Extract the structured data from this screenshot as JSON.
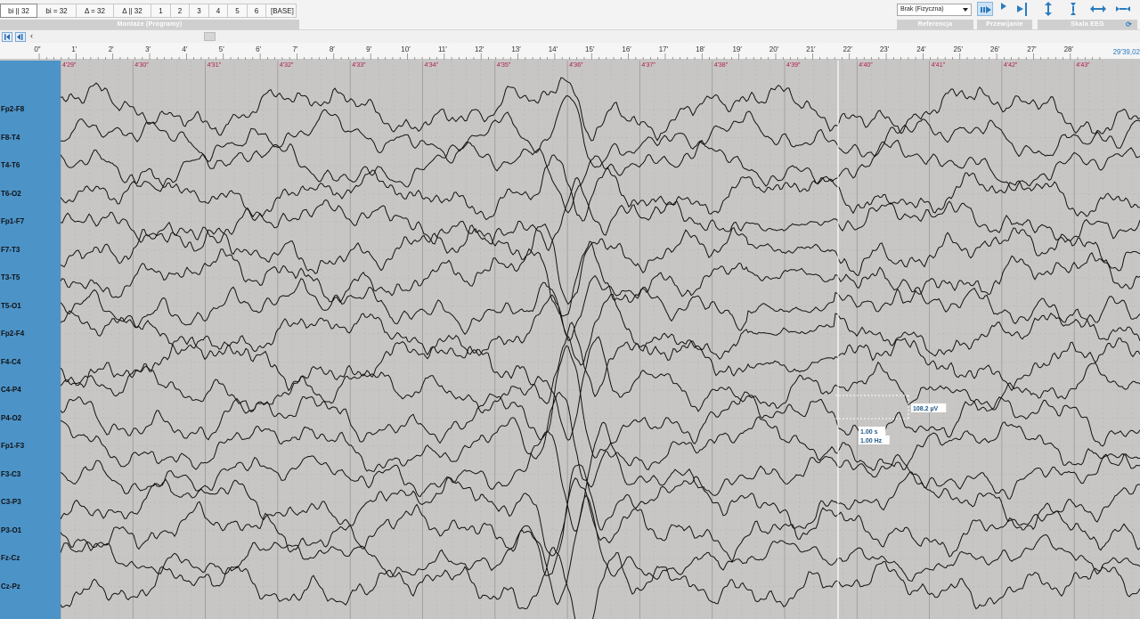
{
  "montage": {
    "buttons": [
      "bi || 32",
      "bi = 32",
      "Δ = 32",
      "Δ || 32",
      "1",
      "2",
      "3",
      "4",
      "5",
      "6",
      "[BASE]"
    ],
    "group_label": "Montaże (Programy)"
  },
  "reference": {
    "selected": "Brak (Fizyczna)",
    "group_label": "Referencja"
  },
  "navigation": {
    "group_label": "Przewijanie",
    "icons": [
      "play-icon",
      "step-forward-icon"
    ]
  },
  "eeg_scale": {
    "group_label": "Skala EEG",
    "icons": [
      "vertical-expand-icon",
      "vertical-shrink-icon",
      "horizontal-expand-icon",
      "horizontal-shrink-icon"
    ]
  },
  "scroll": {
    "left_arrow": "‹",
    "icons": [
      "go-start-icon",
      "step-back-icon"
    ]
  },
  "ruler": {
    "ticks": [
      "0″",
      "1′",
      "2′",
      "3′",
      "4′",
      "5′",
      "6′",
      "7′",
      "8′",
      "9′",
      "10′",
      "11′",
      "12′",
      "13′",
      "14′",
      "15′",
      "16′",
      "17′",
      "18′",
      "19′",
      "20′",
      "21′",
      "22′",
      "23′",
      "24′",
      "25′",
      "26′",
      "27′",
      "28′"
    ],
    "end_label": "29′39,02"
  },
  "realtime_labels": [
    "4′29″",
    "4′30″",
    "4′31″",
    "4′32″",
    "4′33″",
    "4′34″",
    "4′35″",
    "4′36″",
    "4′37″",
    "4′38″",
    "4′39″",
    "4′40″",
    "4′41″",
    "4′42″",
    "4′43″"
  ],
  "channels": [
    "Fp2-F8",
    "F8-T4",
    "T4-T6",
    "T6-O2",
    "Fp1-F7",
    "F7-T3",
    "T3-T5",
    "T5-O1",
    "Fp2-F4",
    "F4-C4",
    "C4-P4",
    "P4-O2",
    "Fp1-F3",
    "F3-C3",
    "C3-P3",
    "P3-O1",
    "Fz-Cz",
    "Cz-Pz"
  ],
  "measurement": {
    "amplitude": "108.2 µV",
    "time": "1.00 s",
    "frequency": "1.00 Hz"
  },
  "colors": {
    "sidebar": "#4c93c8",
    "plot_bg": "#c8c6c5",
    "trace": "#111111",
    "realtime_label": "#b0204d",
    "measure_text": "#1f5a8a"
  }
}
